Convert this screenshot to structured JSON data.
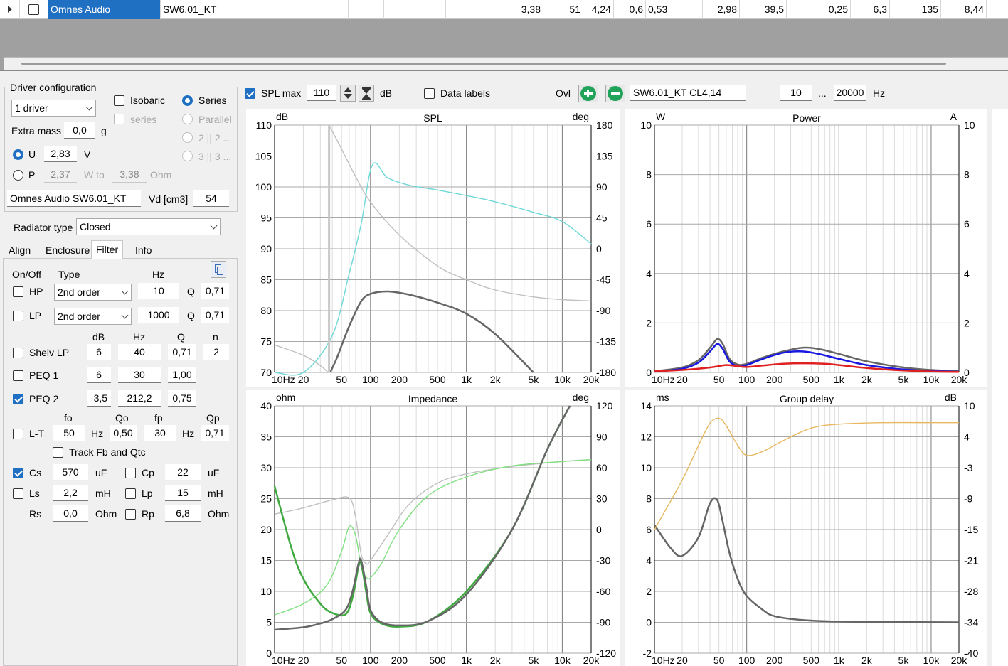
{
  "top_grid": {
    "row": {
      "brand": "Omnes Audio",
      "model": "SW6.01_KT",
      "values": [
        "3,38",
        "51",
        "4,24",
        "0,6",
        "0,53",
        "2,98",
        "39,5",
        "0,25",
        "6,3",
        "135",
        "8,44"
      ]
    }
  },
  "driver_config": {
    "title": "Driver configuration",
    "drivers": "1 driver",
    "isobaric": "Isobaric",
    "series_sub": "series",
    "series": "Series",
    "parallel": "Parallel",
    "opt_2_2": "2 || 2 ...",
    "opt_3_3": "3 || 3 ...",
    "extra_mass_label": "Extra mass",
    "extra_mass": "0,0",
    "extra_mass_unit": "g",
    "u_label": "U",
    "u_value": "2,83",
    "u_unit": "V",
    "p_label": "P",
    "p_value": "2,37",
    "p_unit": "W to",
    "p_ohm": "3,38",
    "ohm_unit": "Ohm",
    "driver_name": "Omnes Audio SW6.01_KT",
    "vd_label": "Vd [cm3]",
    "vd_value": "54"
  },
  "radiator": {
    "label": "Radiator type",
    "value": "Closed"
  },
  "tabs": [
    "Align",
    "Enclosure",
    "Filter",
    "Info"
  ],
  "filter": {
    "h_onoff": "On/Off",
    "h_type": "Type",
    "h_hz": "Hz",
    "hp": {
      "label": "HP",
      "type": "2nd order",
      "hz": "10",
      "q_label": "Q",
      "q": "0,71"
    },
    "lp": {
      "label": "LP",
      "type": "2nd order",
      "hz": "1000",
      "q_label": "Q",
      "q": "0,71"
    },
    "h2_db": "dB",
    "h2_hz": "Hz",
    "h2_q": "Q",
    "h2_n": "n",
    "shelv": {
      "label": "Shelv LP",
      "db": "6",
      "hz": "40",
      "q": "0,71",
      "n": "2"
    },
    "peq1": {
      "label": "PEQ 1",
      "db": "6",
      "hz": "30",
      "q": "1,00"
    },
    "peq2": {
      "label": "PEQ 2",
      "db": "-3,5",
      "hz": "212,2",
      "q": "0,75"
    },
    "h3_fo": "fo",
    "h3_qo": "Qo",
    "h3_fp": "fp",
    "h3_qp": "Qp",
    "lt": {
      "label": "L-T",
      "fo": "50",
      "hz1": "Hz",
      "qo": "0,50",
      "fp": "30",
      "hz2": "Hz",
      "qp": "0,71"
    },
    "track": "Track Fb and Qtc",
    "cs": {
      "label": "Cs",
      "value": "570",
      "unit": "uF"
    },
    "cp": {
      "label": "Cp",
      "value": "22",
      "unit": "uF"
    },
    "ls": {
      "label": "Ls",
      "value": "2,2",
      "unit": "mH"
    },
    "lpp": {
      "label": "Lp",
      "value": "15",
      "unit": "mH"
    },
    "rs": {
      "label": "Rs",
      "value": "0,0",
      "unit": "Ohm"
    },
    "rp": {
      "label": "Rp",
      "value": "6,8",
      "unit": "Ohm"
    }
  },
  "toolbar": {
    "spl_max_label": "SPL max",
    "spl_max": "110",
    "db_unit": "dB",
    "data_labels": "Data labels",
    "ovl": "Ovl",
    "overlay_name": "SW6.01_KT CL4,14",
    "f_min": "10",
    "range_sep": "...",
    "f_max": "20000",
    "hz_unit": "Hz"
  },
  "colors": {
    "spl_gray": "#666666",
    "spl_light": "#c0c0c0",
    "spl_cyan": "#6fd8d8",
    "power_blue": "#1818e0",
    "power_red": "#e02020",
    "imp_green": "#3faa3f",
    "imp_lightgreen": "#80e080",
    "gd_orange": "#e8b860",
    "checkbox": "#1f6fc2"
  },
  "chart_data": [
    {
      "type": "line",
      "title": "SPL",
      "ylabel": "dB",
      "y2label": "deg",
      "x_ticks": [
        "10Hz",
        "20",
        "50",
        "100",
        "200",
        "500",
        "1k",
        "2k",
        "5k",
        "10k",
        "20k"
      ],
      "ylim": [
        70,
        110
      ],
      "y_ticks": [
        "110",
        "105",
        "100",
        "95",
        "90",
        "85",
        "80",
        "75",
        "70"
      ],
      "y2_ticks": [
        "180",
        "135",
        "90",
        "45",
        "0",
        "-45",
        "-90",
        "-135",
        "-180"
      ],
      "series": [
        {
          "color": "#666666",
          "x": [
            38,
            45,
            60,
            80,
            100,
            150,
            250,
            500,
            1000,
            2000,
            5000
          ],
          "y": [
            70,
            72.5,
            77.5,
            81.5,
            82.7,
            83.1,
            82.6,
            81.3,
            79.5,
            76.2,
            70
          ]
        },
        {
          "color": "#c0c0c0",
          "axis": "y2",
          "x": [
            10,
            20,
            30,
            35,
            37
          ],
          "y": [
            -140,
            -155,
            -170,
            -178,
            -180
          ]
        },
        {
          "color": "#c0c0c0",
          "axis": "y2",
          "x": [
            37,
            50,
            70,
            100,
            200,
            500,
            1000,
            2000,
            5000,
            10000,
            20000
          ],
          "y": [
            180,
            145,
            105,
            68,
            20,
            -25,
            -45,
            -60,
            -70,
            -74,
            -76
          ]
        },
        {
          "color": "#6fd8d8",
          "x": [
            10,
            20,
            40,
            60,
            80,
            105,
            150,
            250,
            500,
            1000,
            2000,
            5000,
            10000,
            20000
          ],
          "y": [
            58,
            65,
            76,
            86,
            94,
            103.6,
            101.5,
            100.3,
            99.5,
            98.6,
            97.6,
            95.9,
            94.4,
            90.8
          ]
        }
      ]
    },
    {
      "type": "line",
      "title": "Power",
      "ylabel": "W",
      "y2label": "A",
      "x_ticks": [
        "10Hz",
        "20",
        "50",
        "100",
        "200",
        "500",
        "1k",
        "2k",
        "5k",
        "10k",
        "20k"
      ],
      "ylim": [
        0,
        10
      ],
      "y_ticks": [
        "10",
        "8",
        "6",
        "4",
        "2",
        "0"
      ],
      "y2_ticks": [
        "10",
        "8",
        "6",
        "4",
        "2",
        "0"
      ],
      "series": [
        {
          "color": "#666666",
          "x": [
            10,
            20,
            30,
            40,
            48,
            55,
            65,
            80,
            100,
            150,
            250,
            400,
            600,
            1000,
            2000,
            5000,
            10000,
            20000
          ],
          "y": [
            0.05,
            0.2,
            0.5,
            1,
            1.35,
            1.15,
            0.55,
            0.32,
            0.35,
            0.6,
            0.85,
            1,
            0.95,
            0.75,
            0.45,
            0.2,
            0.1,
            0.05
          ]
        },
        {
          "color": "#1818e0",
          "x": [
            10,
            20,
            30,
            40,
            48,
            55,
            65,
            80,
            100,
            150,
            250,
            400,
            600,
            1000,
            2000,
            5000,
            10000,
            20000
          ],
          "y": [
            0.03,
            0.15,
            0.4,
            0.85,
            1.15,
            0.95,
            0.45,
            0.25,
            0.3,
            0.55,
            0.8,
            0.85,
            0.75,
            0.55,
            0.3,
            0.12,
            0.06,
            0.03
          ]
        },
        {
          "color": "#e02020",
          "x": [
            10,
            20,
            40,
            60,
            80,
            100,
            150,
            250,
            400,
            700,
            1000,
            2000,
            5000,
            10000,
            20000
          ],
          "y": [
            0.05,
            0.1,
            0.2,
            0.3,
            0.25,
            0.22,
            0.28,
            0.35,
            0.37,
            0.35,
            0.3,
            0.18,
            0.08,
            0.04,
            0.02
          ]
        }
      ]
    },
    {
      "type": "line",
      "title": "Impedance",
      "ylabel": "ohm",
      "y2label": "deg",
      "x_ticks": [
        "10Hz",
        "20",
        "50",
        "100",
        "200",
        "500",
        "1k",
        "2k",
        "5k",
        "10k",
        "20k"
      ],
      "ylim": [
        0,
        40
      ],
      "y_ticks": [
        "40",
        "35",
        "30",
        "25",
        "20",
        "15",
        "10",
        "5",
        "0"
      ],
      "y2_ticks": [
        "120",
        "90",
        "60",
        "30",
        "0",
        "-30",
        "-60",
        "-90",
        "-120"
      ],
      "series": [
        {
          "color": "#c0c0c0",
          "x": [
            10,
            20,
            40,
            60,
            70,
            80,
            90,
            100,
            150,
            250,
            500,
            1000,
            3000,
            10000,
            20000
          ],
          "y": [
            22.5,
            23.5,
            24.8,
            25.1,
            22,
            16,
            14.5,
            15,
            19,
            24,
            27.5,
            29,
            30.2,
            31,
            31.3
          ]
        },
        {
          "color": "#80e080",
          "x": [
            10,
            20,
            35,
            50,
            60,
            70,
            80,
            90,
            100,
            130,
            200,
            400,
            1000,
            3000,
            10000,
            20000
          ],
          "y": [
            6.2,
            8,
            11,
            16.5,
            20.5,
            19,
            14,
            12.3,
            12.2,
            14.5,
            20,
            25.5,
            28.5,
            30.3,
            31,
            31.3
          ]
        },
        {
          "color": "#3faa3f",
          "x": [
            10,
            15,
            20,
            30,
            40,
            55,
            65,
            75,
            80,
            90,
            100,
            130,
            200,
            400,
            1000,
            3000,
            7000,
            12000
          ],
          "y": [
            27,
            17,
            12,
            8,
            6.5,
            6.3,
            9,
            14,
            14.5,
            10,
            6.5,
            4.8,
            4.3,
            5.2,
            10,
            20,
            33,
            40
          ]
        },
        {
          "color": "#666666",
          "x": [
            10,
            20,
            30,
            40,
            55,
            65,
            75,
            80,
            90,
            100,
            130,
            200,
            400,
            1000,
            3000,
            7000,
            12000
          ],
          "y": [
            3.8,
            4.2,
            4.8,
            5.5,
            7,
            10,
            14.5,
            15,
            11,
            7,
            5,
            4.5,
            5.2,
            9.5,
            20,
            33,
            40
          ]
        }
      ]
    },
    {
      "type": "line",
      "title": "Group delay",
      "ylabel": "ms",
      "y2label": "dB",
      "x_ticks": [
        "10Hz",
        "20",
        "50",
        "100",
        "200",
        "500",
        "1k",
        "2k",
        "5k",
        "10k",
        "20k"
      ],
      "ylim": [
        -2,
        14
      ],
      "y_ticks": [
        "14",
        "12",
        "10",
        "8",
        "6",
        "4",
        "2",
        "0",
        "-2"
      ],
      "y2_ticks": [
        "10",
        "4",
        "-3",
        "-9",
        "-15",
        "-21",
        "-28",
        "-34",
        "-40"
      ],
      "series": [
        {
          "color": "#666666",
          "x": [
            10,
            15,
            20,
            30,
            40,
            48,
            55,
            65,
            80,
            100,
            150,
            200,
            400,
            1000,
            5000,
            20000
          ],
          "y": [
            6.3,
            4.8,
            4.3,
            5.5,
            7.7,
            7.9,
            6.5,
            4.5,
            2.8,
            1.7,
            0.8,
            0.4,
            0.15,
            0.05,
            0.02,
            0
          ]
        },
        {
          "color": "#e8b860",
          "axis": "y2",
          "x": [
            10,
            20,
            30,
            40,
            50,
            60,
            80,
            100,
            150,
            250,
            500,
            1000,
            3000,
            10000,
            20000
          ],
          "y": [
            -15,
            -5,
            2,
            6.5,
            7.5,
            6,
            2,
            0,
            0.8,
            3,
            5.5,
            6.3,
            6.6,
            6.6,
            6.6
          ]
        }
      ]
    }
  ]
}
